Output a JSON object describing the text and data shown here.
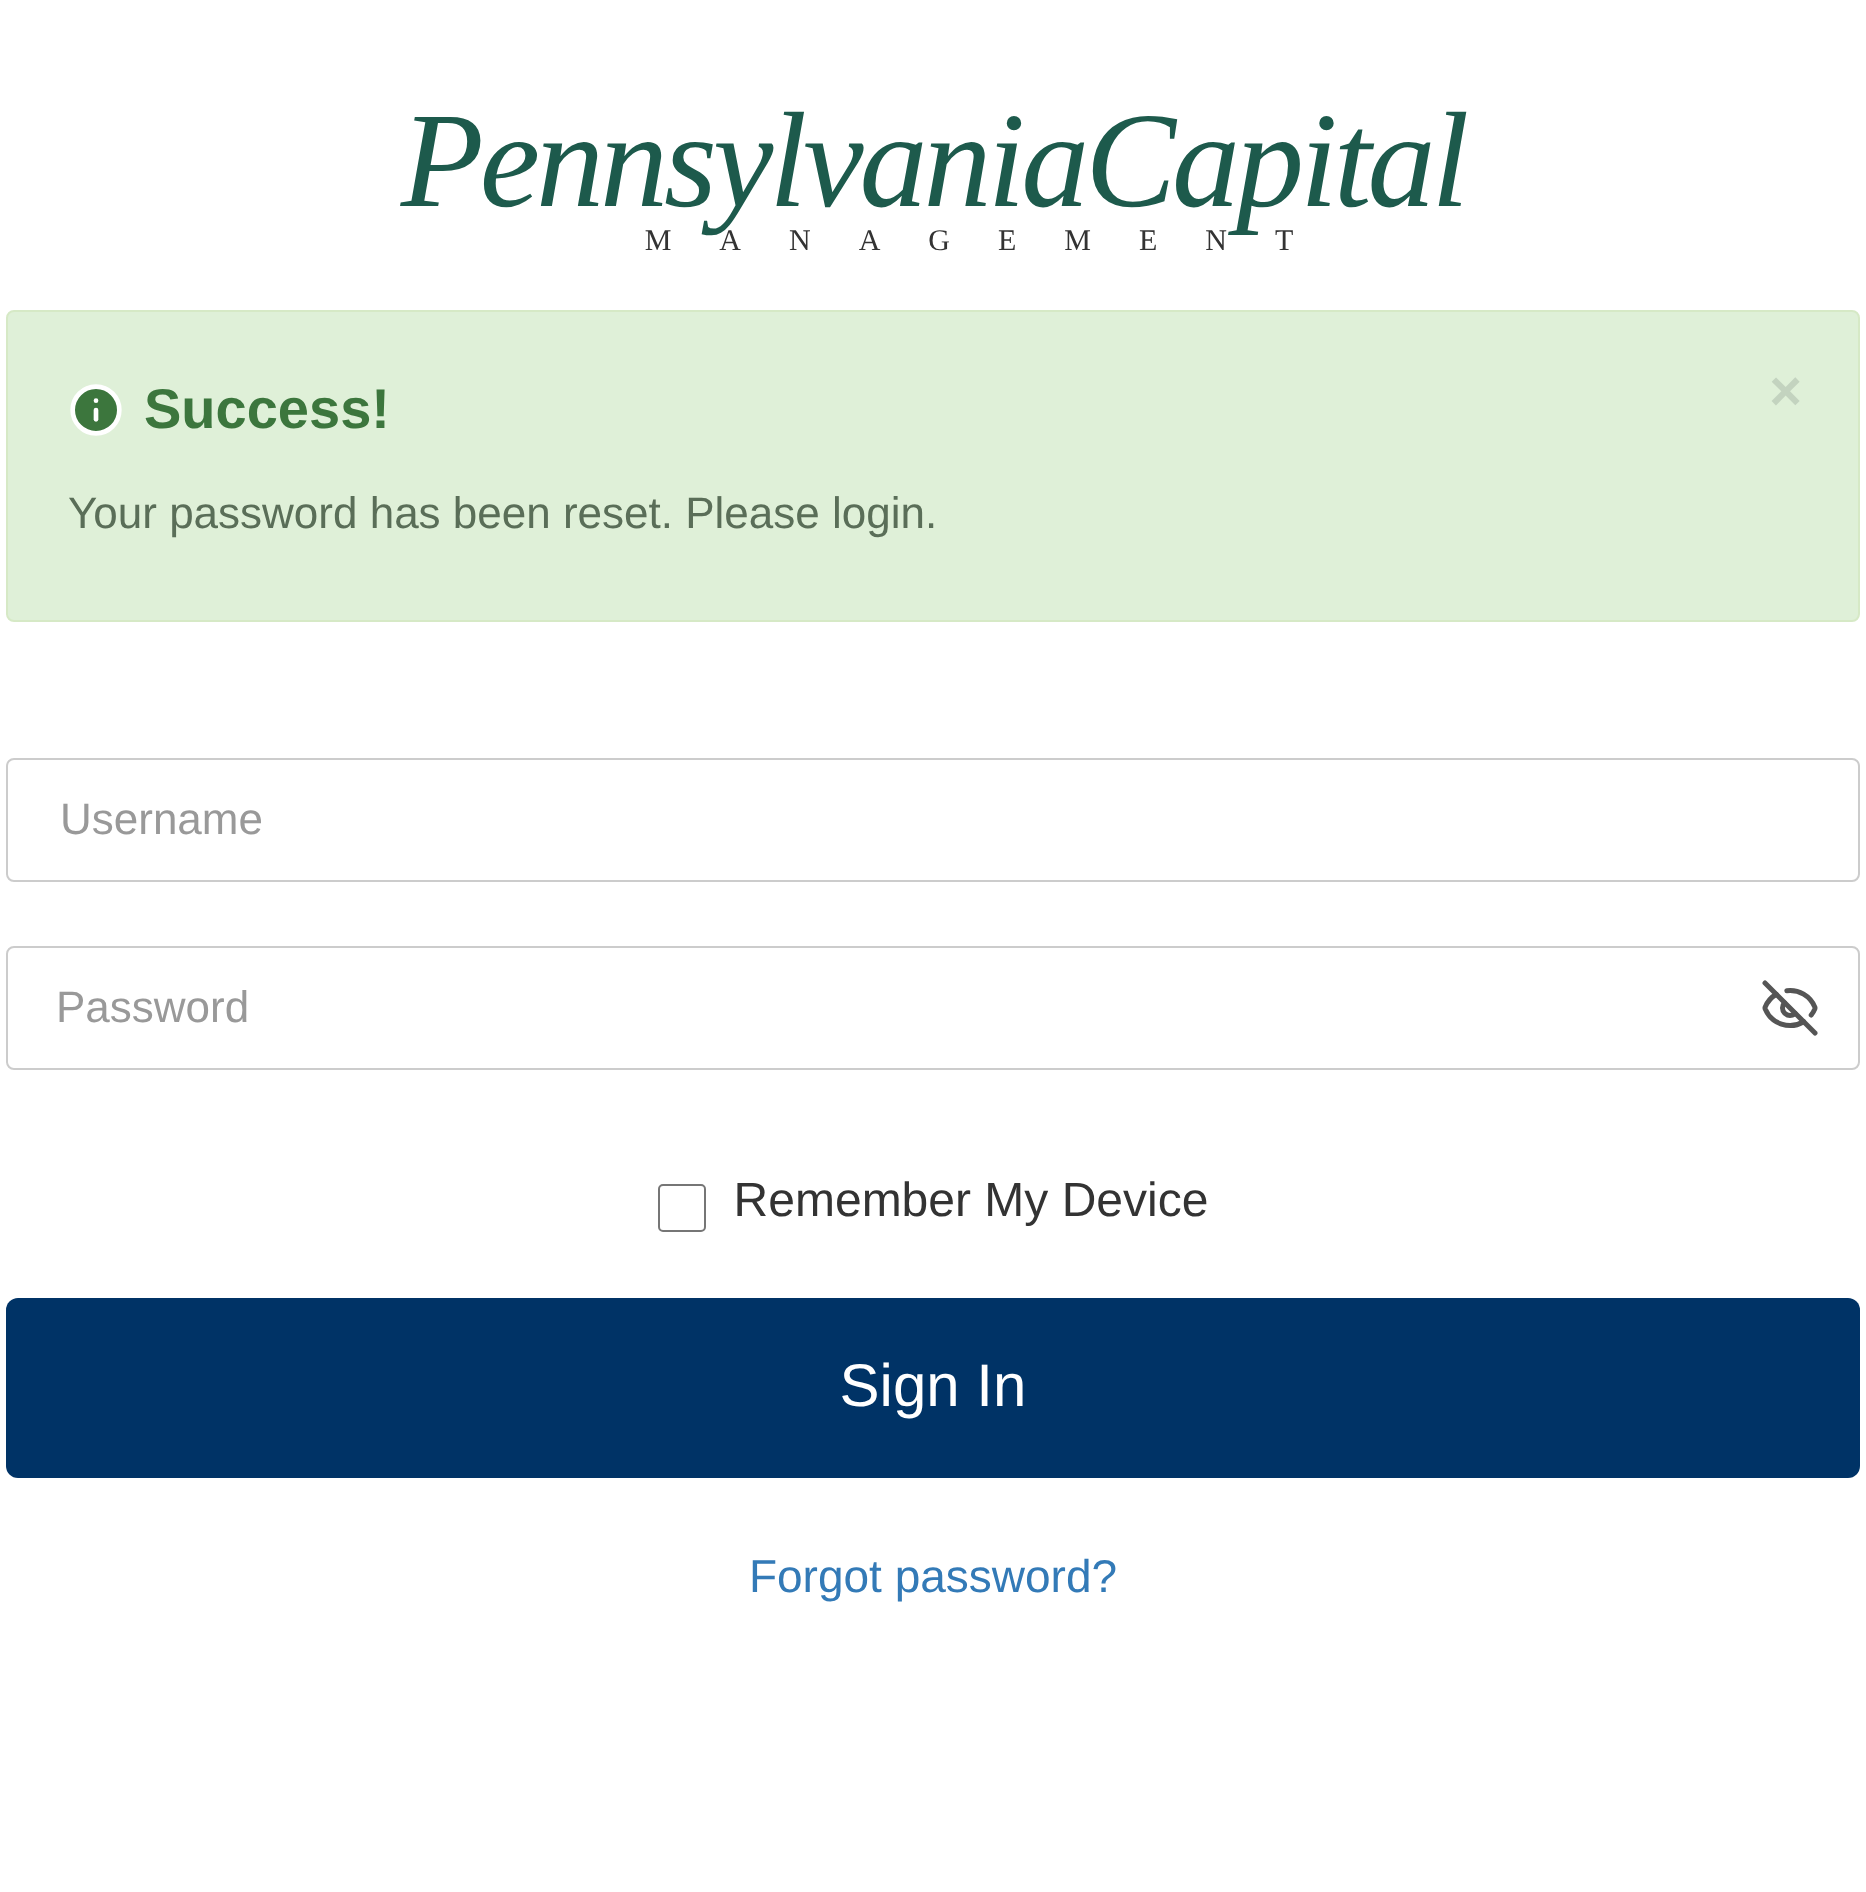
{
  "logo": {
    "name": "PennsylvaniaCapital",
    "tagline": "MANAGEMENT"
  },
  "alert": {
    "title": "Success!",
    "message": "Your password has been reset. Please login.",
    "close": "×"
  },
  "username": {
    "placeholder": "Username"
  },
  "password": {
    "placeholder": "Password",
    "visible": false
  },
  "remember": {
    "label": "Remember My Device",
    "checked": false
  },
  "sign_in": "Sign In",
  "forgot": "Forgot password?"
}
